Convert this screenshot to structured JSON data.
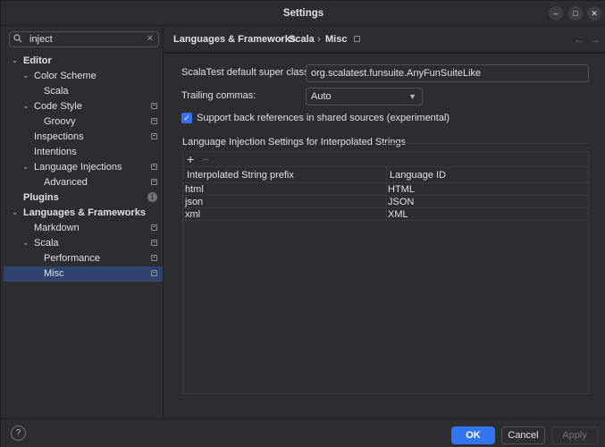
{
  "window": {
    "title": "Settings"
  },
  "search": {
    "value": "inject"
  },
  "sidebar": {
    "items": [
      {
        "label": "Editor",
        "bold": true,
        "expanded": true,
        "level": 0
      },
      {
        "label": "Color Scheme",
        "expanded": true,
        "level": 1
      },
      {
        "label": "Scala",
        "level": 2
      },
      {
        "label": "Code Style",
        "expanded": true,
        "level": 1,
        "project": true
      },
      {
        "label": "Groovy",
        "level": 2,
        "project": true
      },
      {
        "label": "Inspections",
        "level": 1,
        "project": true
      },
      {
        "label": "Intentions",
        "level": 1
      },
      {
        "label": "Language Injections",
        "expanded": true,
        "level": 1,
        "project": true
      },
      {
        "label": "Advanced",
        "level": 2,
        "project": true
      },
      {
        "label": "Plugins",
        "bold": true,
        "level": 0,
        "badge": "1"
      },
      {
        "label": "Languages & Frameworks",
        "bold": true,
        "expanded": true,
        "level": 0
      },
      {
        "label": "Markdown",
        "level": 1,
        "project": true
      },
      {
        "label": "Scala",
        "expanded": true,
        "level": 1,
        "project": true
      },
      {
        "label": "Performance",
        "level": 2,
        "project": true
      },
      {
        "label": "Misc",
        "level": 2,
        "project": true,
        "selected": true
      }
    ]
  },
  "breadcrumb": {
    "part1": "Languages & Frameworks",
    "part2": "Scala",
    "part3": "Misc",
    "sep": "›"
  },
  "form": {
    "super_class_label": "ScalaTest default super class:",
    "super_class_value": "org.scalatest.funsuite.AnyFunSuiteLike",
    "trailing_commas_label": "Trailing commas:",
    "trailing_commas_value": "Auto",
    "back_refs_label": "Support back references in shared sources (experimental)",
    "back_refs_checked": true
  },
  "injection": {
    "section_title": "Language Injection Settings for Interpolated Strings",
    "add_label": "+",
    "remove_label": "−",
    "columns": [
      "Interpolated String prefix",
      "Language ID"
    ],
    "rows": [
      [
        "html",
        "HTML"
      ],
      [
        "json",
        "JSON"
      ],
      [
        "xml",
        "XML"
      ]
    ]
  },
  "footer": {
    "help": "?",
    "ok": "OK",
    "cancel": "Cancel",
    "apply": "Apply"
  },
  "colors": {
    "accent": "#3574f0",
    "selection": "#2e436e",
    "background": "#2b2d30"
  }
}
